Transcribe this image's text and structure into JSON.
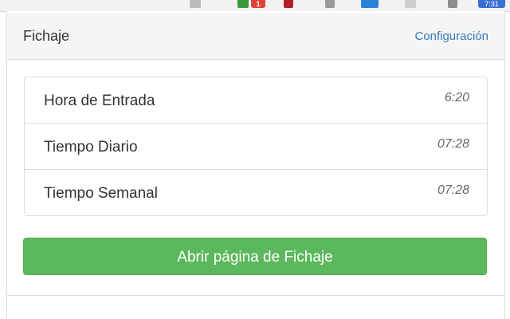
{
  "browser": {
    "badge_count": "1",
    "badge_right": "7:31"
  },
  "header": {
    "title": "Fichaje",
    "config_label": "Configuración"
  },
  "rows": [
    {
      "label": "Hora de Entrada",
      "value": "6:20"
    },
    {
      "label": "Tiempo Diario",
      "value": "07:28"
    },
    {
      "label": "Tiempo Semanal",
      "value": "07:28"
    }
  ],
  "actions": {
    "open_label": "Abrir página de Fichaje"
  },
  "colors": {
    "accent": "#5cb85c",
    "link": "#337ab7",
    "header_bg": "#f5f5f5"
  }
}
